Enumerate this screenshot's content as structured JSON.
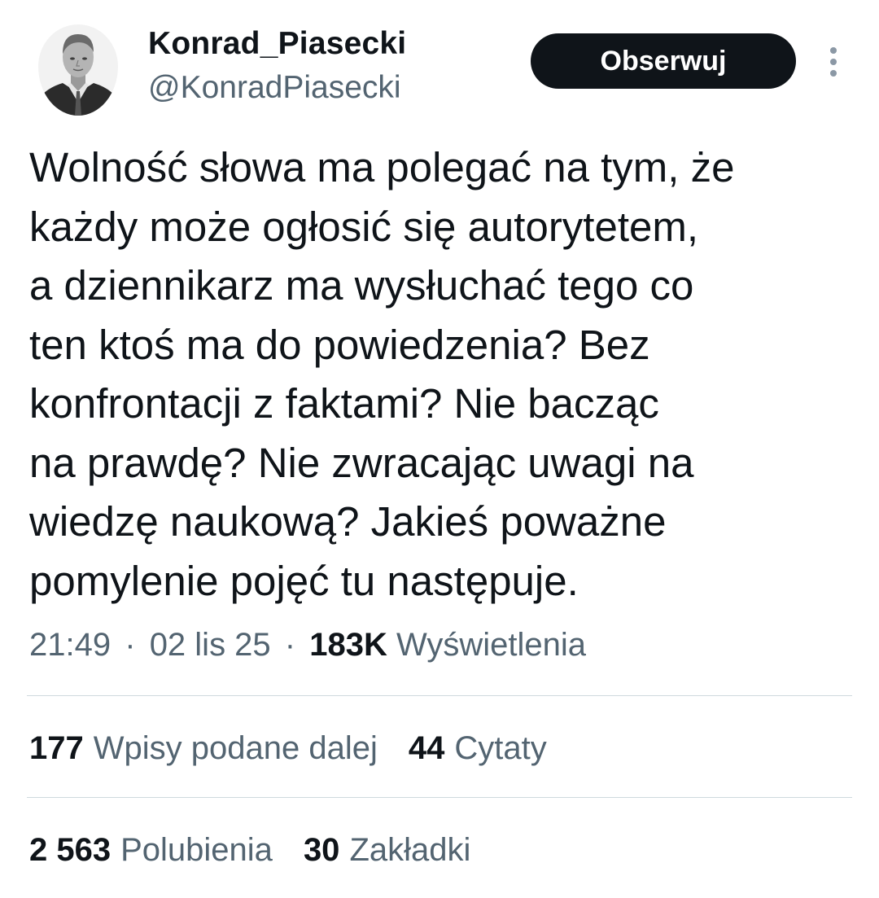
{
  "user": {
    "display_name": "Konrad_Piasecki",
    "handle": "@KonradPiasecki"
  },
  "follow_button": {
    "label": "Obserwuj"
  },
  "more_menu_icon": "vertical-dots-icon",
  "tweet": {
    "lines": [
      "Wolność słowa ma polegać na tym, że",
      "każdy może ogłosić się autorytetem,",
      "a dziennikarz ma wysłuchać tego co",
      "ten ktoś ma do powiedzenia? Bez",
      "konfrontacji z faktami? Nie bacząc",
      "na prawdę? Nie zwracając uwagi na",
      "wiedzę naukową? Jakieś poważne",
      "pomylenie pojęć tu następuje."
    ]
  },
  "meta": {
    "time": "21:49",
    "date": "02 lis 25",
    "separator": "·",
    "views_count": "183K",
    "views_label": "Wyświetlenia"
  },
  "stats": {
    "reposts": {
      "count": "177",
      "label": "Wpisy podane dalej"
    },
    "quotes": {
      "count": "44",
      "label": "Cytaty"
    },
    "likes": {
      "count": "2 563",
      "label": "Polubienia"
    },
    "bookmarks": {
      "count": "30",
      "label": "Zakładki"
    }
  },
  "colors": {
    "text_primary": "#0f1419",
    "text_secondary": "#536471",
    "divider": "#cfd9de",
    "button_bg": "#0f1419",
    "button_text": "#ffffff",
    "more_icon": "#8b98a5"
  }
}
